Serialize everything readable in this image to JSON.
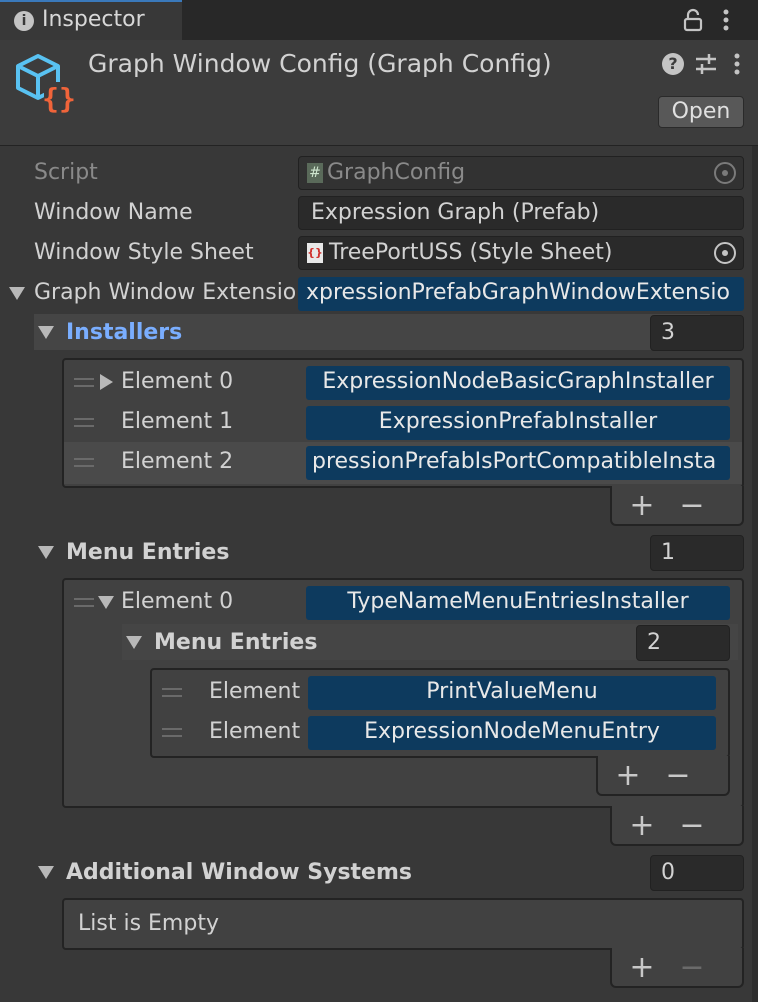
{
  "tab": {
    "label": "Inspector"
  },
  "header": {
    "title": "Graph Window Config (Graph Config)",
    "open_label": "Open"
  },
  "props": {
    "script_label": "Script",
    "script_value": "GraphConfig",
    "window_name_label": "Window Name",
    "window_name_value": "Expression Graph (Prefab)",
    "style_sheet_label": "Window Style Sheet",
    "style_sheet_value": "TreePortUSS (Style Sheet)",
    "extension_label": "Graph Window Extensio",
    "extension_value": "xpressionPrefabGraphWindowExtensio"
  },
  "installers": {
    "label": "Installers",
    "count": "3",
    "elements": [
      {
        "label": "Element 0",
        "value": "ExpressionNodeBasicGraphInstaller"
      },
      {
        "label": "Element 1",
        "value": "ExpressionPrefabInstaller"
      },
      {
        "label": "Element 2",
        "value": "pressionPrefabIsPortCompatibleInsta"
      }
    ]
  },
  "menu_entries": {
    "label": "Menu Entries",
    "count": "1",
    "element0_label": "Element 0",
    "element0_value": "TypeNameMenuEntriesInstaller",
    "inner": {
      "label": "Menu Entries",
      "count": "2",
      "elements": [
        {
          "label": "Element",
          "value": "PrintValueMenu"
        },
        {
          "label": "Element",
          "value": "ExpressionNodeMenuEntry"
        }
      ]
    }
  },
  "additional": {
    "label": "Additional Window Systems",
    "count": "0",
    "empty_text": "List is Empty"
  },
  "buttons": {
    "plus": "+",
    "minus": "−"
  },
  "colors": {
    "accent_blue": "#7aaeff",
    "object_field": "#0d3a5e",
    "background": "#383838"
  }
}
